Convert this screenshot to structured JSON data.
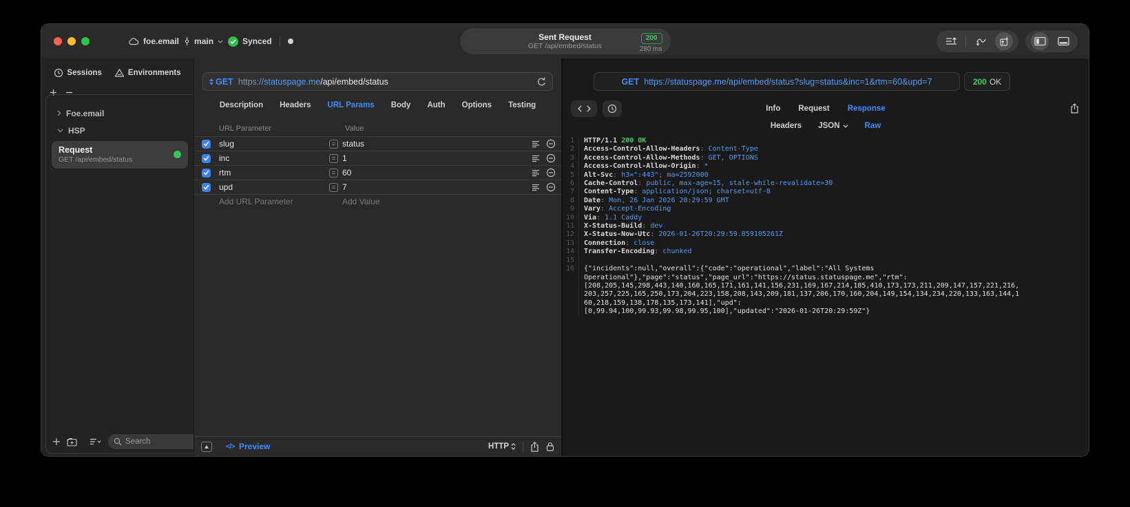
{
  "titlebar": {
    "project": "foe.email",
    "branch": "main",
    "sync_label": "Synced",
    "sent": {
      "title": "Sent Request",
      "subtitle": "GET /api/embed/status",
      "code": "200",
      "time": "280 ms"
    }
  },
  "sidebar": {
    "tabs": [
      {
        "label": "Sessions"
      },
      {
        "label": "Environments"
      }
    ],
    "tree": [
      {
        "label": "Foe.email"
      },
      {
        "label": "HSP"
      }
    ],
    "request": {
      "title": "Request",
      "subtitle": "GET /api/embed/status"
    },
    "search_placeholder": "Search"
  },
  "request_panel": {
    "method": "GET",
    "url": {
      "scheme": "https://",
      "host": "statuspage.me",
      "path": "/api/embed/status"
    },
    "tabs": [
      "Description",
      "Headers",
      "URL Params",
      "Body",
      "Auth",
      "Options",
      "Testing"
    ],
    "active_tab": "URL Params",
    "params": {
      "col_name": "URL Parameter",
      "col_value": "Value",
      "rows": [
        {
          "name": "slug",
          "value": "status",
          "enabled": true
        },
        {
          "name": "inc",
          "value": "1",
          "enabled": true
        },
        {
          "name": "rtm",
          "value": "60",
          "enabled": true
        },
        {
          "name": "upd",
          "value": "7",
          "enabled": true
        }
      ],
      "add_name": "Add URL Parameter",
      "add_value": "Add Value"
    },
    "footer": {
      "preview": "Preview",
      "code_glyph": "</>",
      "protocol": "HTTP"
    }
  },
  "response_panel": {
    "method": "GET",
    "url": "https://statuspage.me/api/embed/status?slug=status&inc=1&rtm=60&upd=7",
    "status_code": "200",
    "status_text": "OK",
    "tabs": [
      "Info",
      "Request",
      "Response"
    ],
    "active_tab": "Response",
    "subtabs": [
      "Headers",
      "JSON",
      "Raw"
    ],
    "active_subtab": "Raw",
    "status_line": "HTTP/1.1",
    "status_line_value": "200 OK",
    "headers": [
      {
        "name": "Access-Control-Allow-Headers",
        "value": "Content-Type"
      },
      {
        "name": "Access-Control-Allow-Methods",
        "value": "GET, OPTIONS"
      },
      {
        "name": "Access-Control-Allow-Origin",
        "value": "*"
      },
      {
        "name": "Alt-Svc",
        "value": "h3=\":443\"; ma=2592000"
      },
      {
        "name": "Cache-Control",
        "value": "public, max-age=15, stale-while-revalidate=30"
      },
      {
        "name": "Content-Type",
        "value": "application/json; charset=utf-8"
      },
      {
        "name": "Date",
        "value": "Mon, 26 Jan 2026 20:29:59 GMT"
      },
      {
        "name": "Vary",
        "value": "Accept-Encoding"
      },
      {
        "name": "Via",
        "value": "1.1 Caddy"
      },
      {
        "name": "X-Status-Build",
        "value": "dev"
      },
      {
        "name": "X-Status-Now-Utc",
        "value": "2026-01-26T20:29:59.859105261Z"
      },
      {
        "name": "Connection",
        "value": "close"
      },
      {
        "name": "Transfer-Encoding",
        "value": "chunked"
      }
    ],
    "body_lines": [
      "{\"incidents\":null,\"overall\":{\"code\":\"operational\",\"label\":\"All Systems",
      "Operational\"},\"page\":\"status\",\"page_url\":\"https://status.statuspage.me\",\"rtm\":",
      "[208,205,145,298,443,140,160,165,171,161,141,156,231,169,167,214,185,410,173,173,211,209,147,157,221,216,",
      "203,257,225,165,250,173,204,223,158,208,143,209,181,137,206,170,160,204,149,154,134,234,220,133,163,144,1",
      "60,218,159,138,178,135,173,141],\"upd\":",
      "[0,99.94,100,99.93,99.98,99.95,100],\"updated\":\"2026-01-26T20:29:59Z\"}"
    ]
  }
}
